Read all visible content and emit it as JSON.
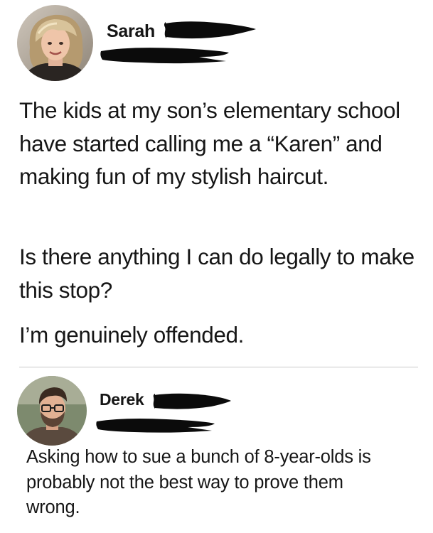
{
  "post": {
    "author": "Sarah",
    "paragraphs": [
      "The kids at my son’s elementary school have started calling me a “Karen” and making fun of my stylish haircut.",
      "Is there anything I can do legally to make this stop?",
      "I’m genuinely offended."
    ]
  },
  "reply": {
    "author": "Derek",
    "text": "Asking how to sue a bunch of 8-year-olds is probably not the best way to prove them wrong."
  },
  "colors": {
    "text": "#161616",
    "redaction": "#0b0b0b",
    "divider": "#c9c9c9"
  },
  "icons": {
    "post_avatar": "woman-portrait-avatar",
    "reply_avatar": "man-portrait-avatar"
  }
}
